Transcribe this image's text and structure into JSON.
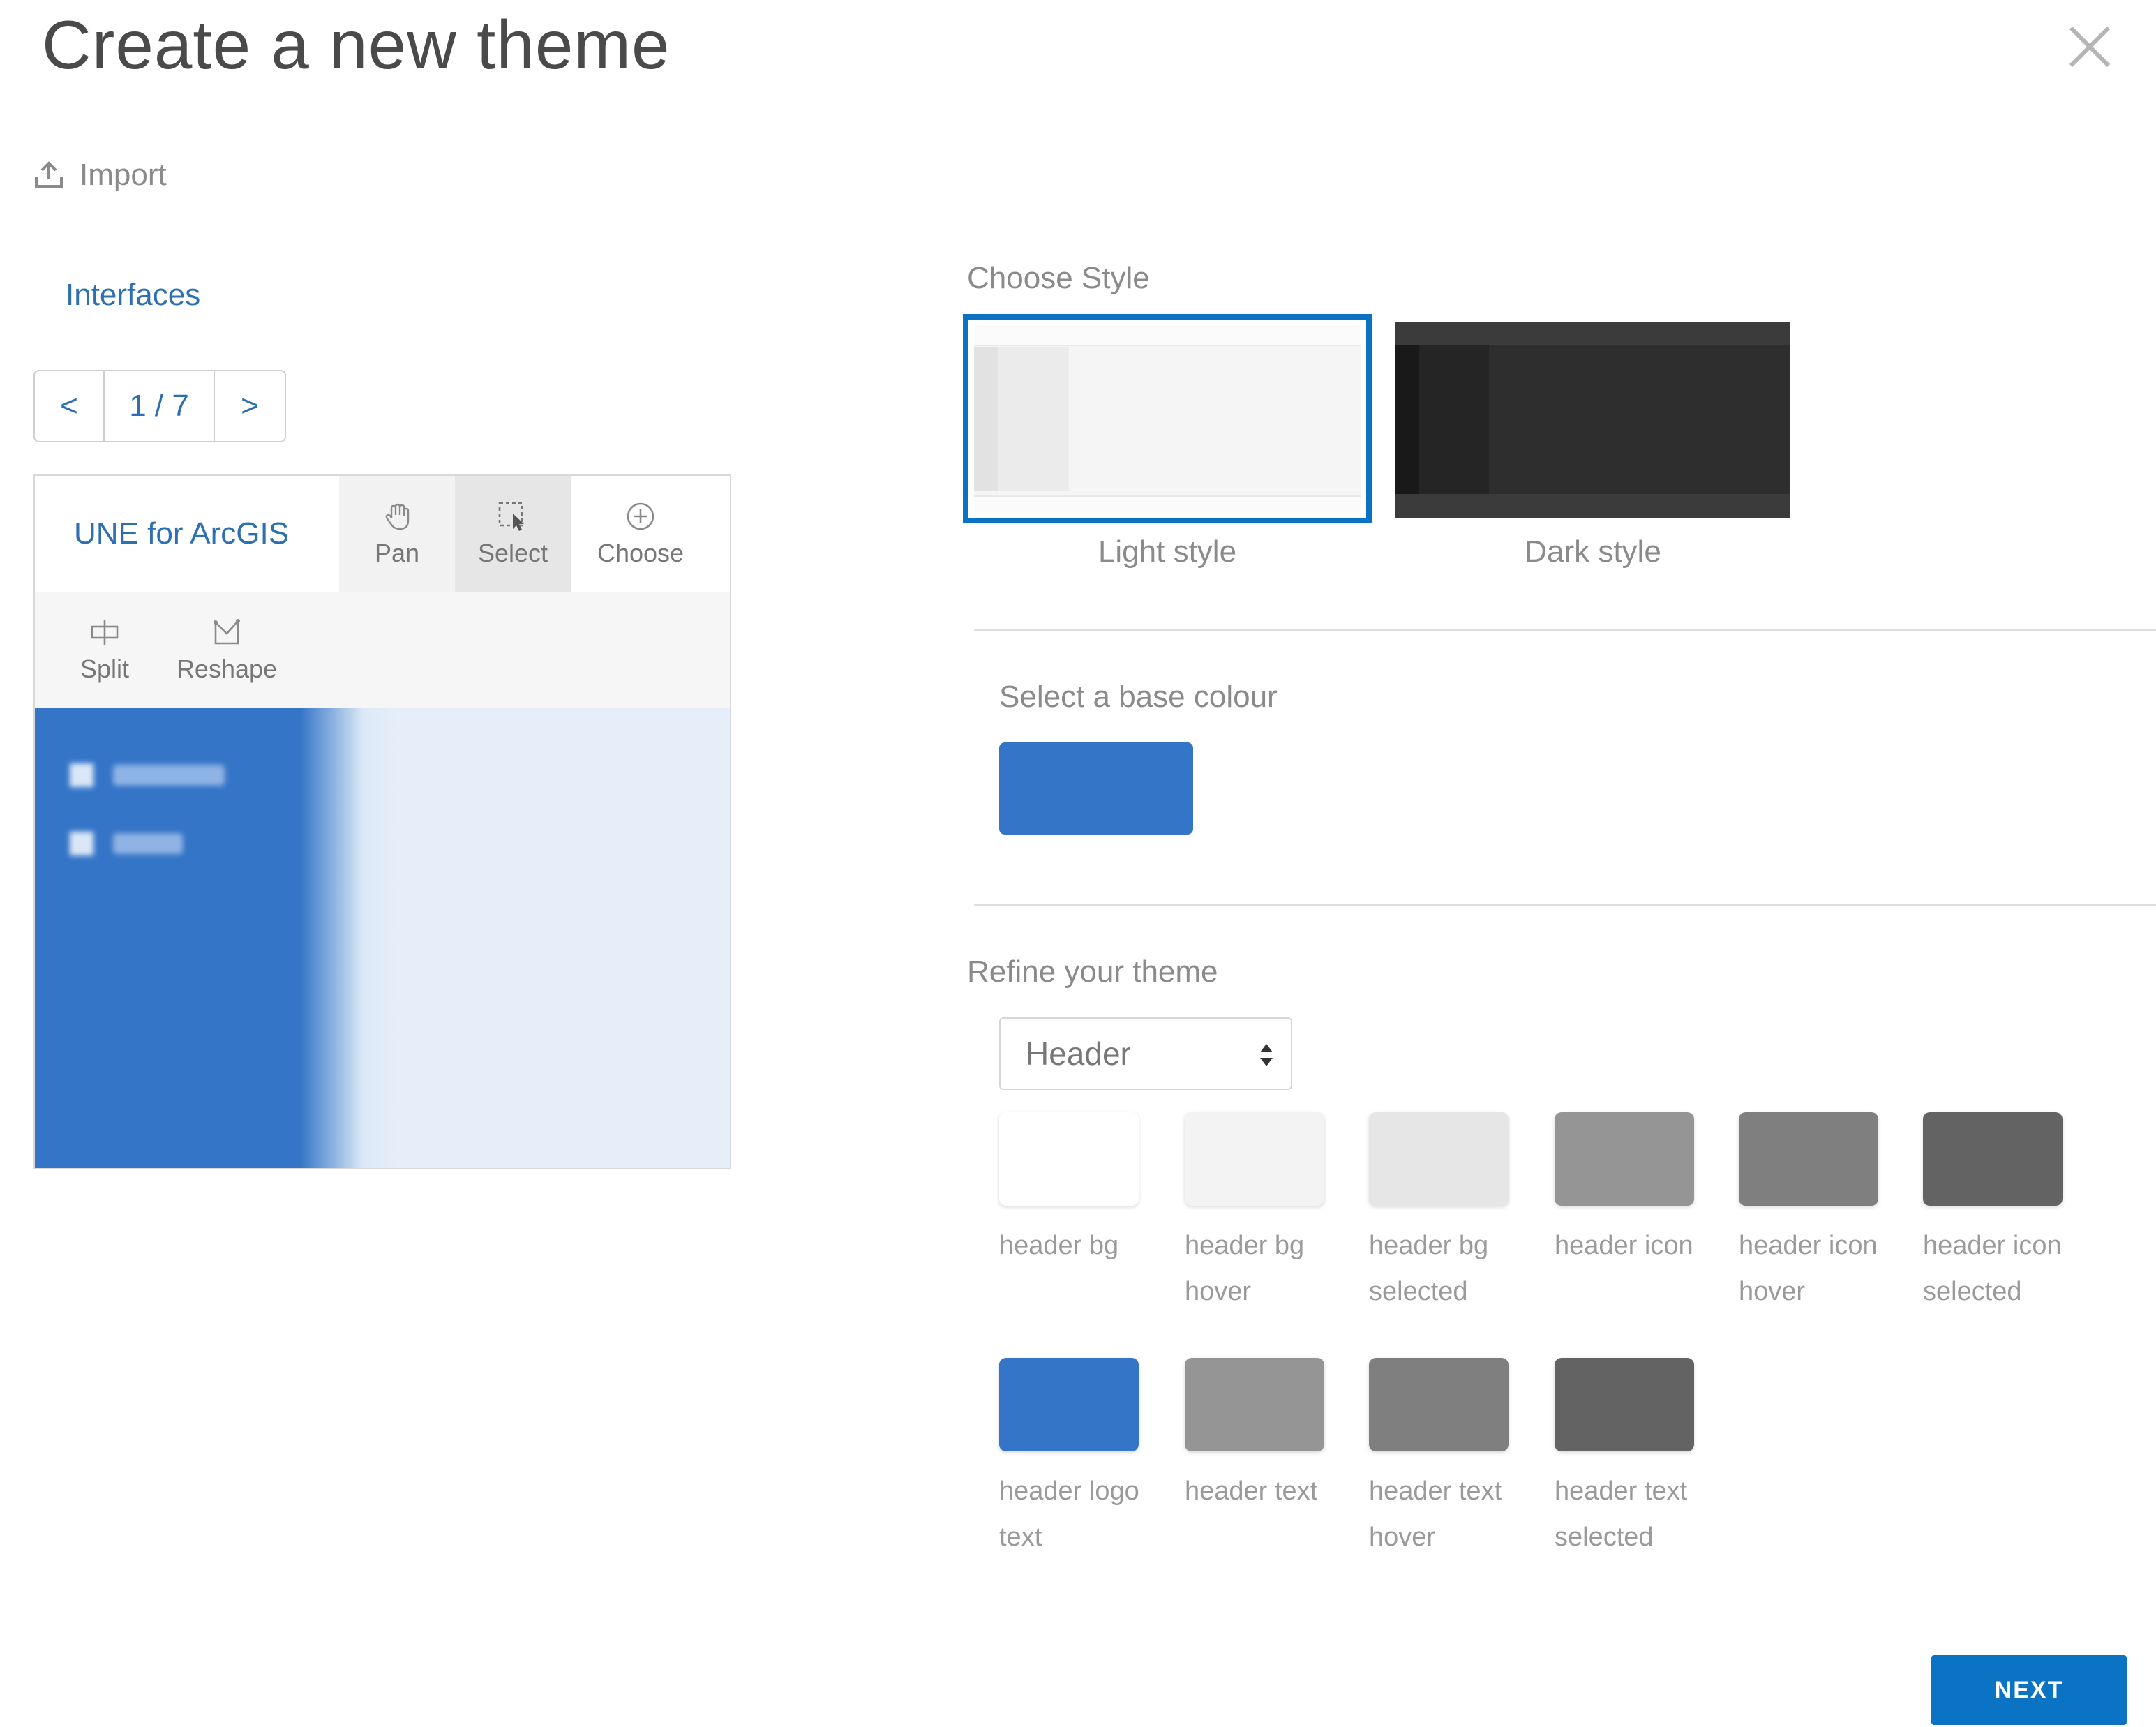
{
  "dialog": {
    "title": "Create a new theme",
    "close_icon": "close-icon"
  },
  "import": {
    "label": "Import",
    "icon": "upload-icon"
  },
  "preview_panel": {
    "section_label": "Interfaces",
    "pager": {
      "prev_label": "<",
      "count": "1 / 7",
      "next_label": ">"
    },
    "app_name": "UNE for ArcGIS",
    "tools": [
      {
        "label": "Pan",
        "icon": "hand-icon"
      },
      {
        "label": "Select",
        "icon": "select-icon"
      },
      {
        "label": "Choose",
        "icon": "plus-circle-icon"
      },
      {
        "label": "Split",
        "icon": "split-icon"
      },
      {
        "label": "Reshape",
        "icon": "reshape-icon"
      }
    ],
    "accent_color": "#3575c7"
  },
  "style": {
    "label": "Choose Style",
    "options": [
      {
        "label": "Light style",
        "selected": true
      },
      {
        "label": "Dark style",
        "selected": false
      }
    ],
    "selection_color": "#0b73c4"
  },
  "base_colour": {
    "label": "Select a base colour",
    "value": "#3575c7"
  },
  "refine": {
    "label": "Refine your theme",
    "selected_section": "Header",
    "swatches": [
      {
        "label": "header bg",
        "color": "#ffffff"
      },
      {
        "label": "header bg hover",
        "color": "#f3f3f3"
      },
      {
        "label": "header bg selected",
        "color": "#e6e6e6"
      },
      {
        "label": "header icon",
        "color": "#959595"
      },
      {
        "label": "header icon hover",
        "color": "#7f7f7f"
      },
      {
        "label": "header icon selected",
        "color": "#636363"
      },
      {
        "label": "header logo text",
        "color": "#3575c7"
      },
      {
        "label": "header text",
        "color": "#959595"
      },
      {
        "label": "header text hover",
        "color": "#7f7f7f"
      },
      {
        "label": "header text selected",
        "color": "#636363"
      }
    ]
  },
  "footer": {
    "next_label": "NEXT"
  }
}
